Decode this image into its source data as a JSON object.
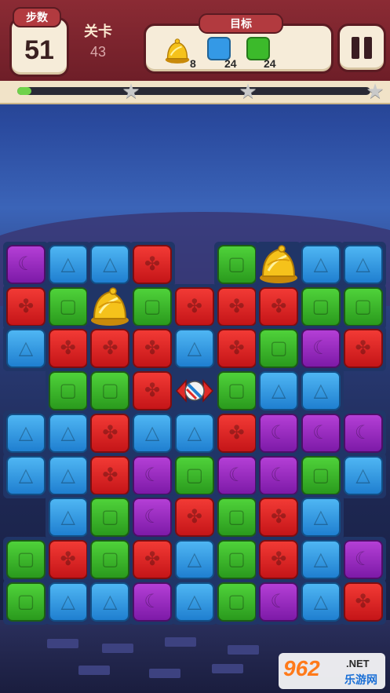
{
  "hud": {
    "moves_label": "步数",
    "moves_value": "51",
    "level_label": "关卡",
    "level_value": "43",
    "goal_label": "目标",
    "goals": [
      {
        "icon": "golden-bell",
        "count": "8"
      },
      {
        "icon": "blue-block",
        "count": "24"
      },
      {
        "icon": "green-block",
        "count": "24"
      }
    ],
    "progress_fraction": 0.04,
    "stars_earned": 0,
    "stars_total": 3
  },
  "board": {
    "rows": [
      [
        "P",
        "B",
        "B",
        "R",
        "_",
        "G",
        "Y",
        "B",
        "B"
      ],
      [
        "R",
        "G",
        "Y",
        "G",
        "R",
        "R",
        "R",
        "G",
        "G"
      ],
      [
        "B",
        "R",
        "R",
        "R",
        "B",
        "R",
        "G",
        "P",
        "R"
      ],
      [
        "_",
        "G",
        "G",
        "R",
        "C",
        "G",
        "B",
        "B",
        "_"
      ],
      [
        "B",
        "B",
        "R",
        "B",
        "B",
        "R",
        "P",
        "P",
        "P"
      ],
      [
        "B",
        "B",
        "R",
        "P",
        "G",
        "P",
        "P",
        "G",
        "B"
      ],
      [
        "_",
        "B",
        "G",
        "P",
        "R",
        "G",
        "R",
        "B",
        "_"
      ],
      [
        "G",
        "R",
        "G",
        "R",
        "B",
        "G",
        "R",
        "B",
        "P"
      ],
      [
        "G",
        "B",
        "B",
        "P",
        "B",
        "G",
        "P",
        "B",
        "R"
      ]
    ],
    "legend": {
      "R": "red",
      "G": "green",
      "B": "blue",
      "P": "purple",
      "Y": "golden-bell",
      "C": "striped-candy",
      "_": "empty"
    }
  },
  "watermark": {
    "logo": "962",
    "net": ".NET",
    "site": "乐游网"
  },
  "colors": {
    "header": "#7a2530",
    "red": "#e02a28",
    "green": "#3cba2b",
    "blue": "#3499e6",
    "purple": "#9a2cc2",
    "progress": "#6fd24a"
  }
}
